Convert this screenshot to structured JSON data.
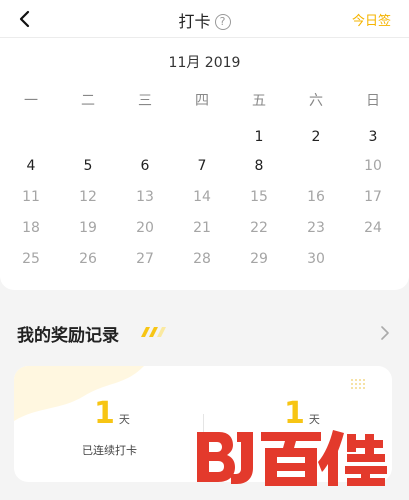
{
  "header": {
    "title": "打卡",
    "help_symbol": "?",
    "checkin_link": "今日签"
  },
  "calendar": {
    "month_label": "11月 2019",
    "weekdays": [
      "一",
      "二",
      "三",
      "四",
      "五",
      "六",
      "日"
    ],
    "rows": [
      [
        "",
        "",
        "",
        "",
        "1",
        "2",
        "3"
      ],
      [
        "4",
        "5",
        "6",
        "7",
        "8",
        "9",
        "10"
      ],
      [
        "11",
        "12",
        "13",
        "14",
        "15",
        "16",
        "17"
      ],
      [
        "18",
        "19",
        "20",
        "21",
        "22",
        "23",
        "24"
      ],
      [
        "25",
        "26",
        "27",
        "28",
        "29",
        "30",
        ""
      ]
    ],
    "today": "9",
    "accent_color": "#f7c514"
  },
  "rewards": {
    "title": "我的奖励记录",
    "stats": [
      {
        "value": "1",
        "unit": "天",
        "label": "已连续打卡"
      },
      {
        "value": "1",
        "unit": "天"
      }
    ]
  },
  "watermark": {
    "text": "百佳"
  }
}
